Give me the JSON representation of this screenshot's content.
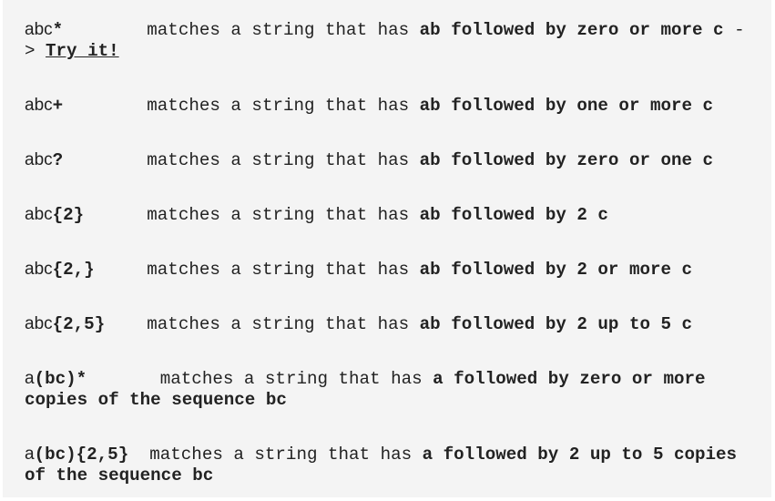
{
  "entries": [
    {
      "base": "abc",
      "op": "*",
      "gap": "        ",
      "plain": "matches a string that has ",
      "bold": "ab followed by zero or more c",
      "tail": " -> ",
      "link": "Try it!"
    },
    {
      "base": "abc",
      "op": "+",
      "gap": "        ",
      "plain": "matches a string that has ",
      "bold": "ab followed by one or more c"
    },
    {
      "base": "abc",
      "op": "?",
      "gap": "        ",
      "plain": "matches a string that has ",
      "bold": "ab followed by zero or one c"
    },
    {
      "base": "abc",
      "op": "{2}",
      "gap": "      ",
      "plain": "matches a string that has ",
      "bold": "ab followed by 2 c"
    },
    {
      "base": "abc",
      "op": "{2,}",
      "gap": "     ",
      "plain": "matches a string that has ",
      "bold": "ab followed by 2 or more c"
    },
    {
      "base": "abc",
      "op": "{2,5}",
      "gap": "    ",
      "plain": "matches a string that has ",
      "bold": "ab followed by 2 up to 5 c"
    },
    {
      "base": "a",
      "op": "(bc)*",
      "gap": "       ",
      "plain": "matches a string that has ",
      "bold": "a followed by zero or more copies of the sequence bc"
    },
    {
      "base": "a",
      "op": "(bc){2,5}",
      "gap": "  ",
      "plain": "matches a string that has ",
      "bold": "a followed by 2 up to 5 copies of the sequence bc"
    }
  ]
}
